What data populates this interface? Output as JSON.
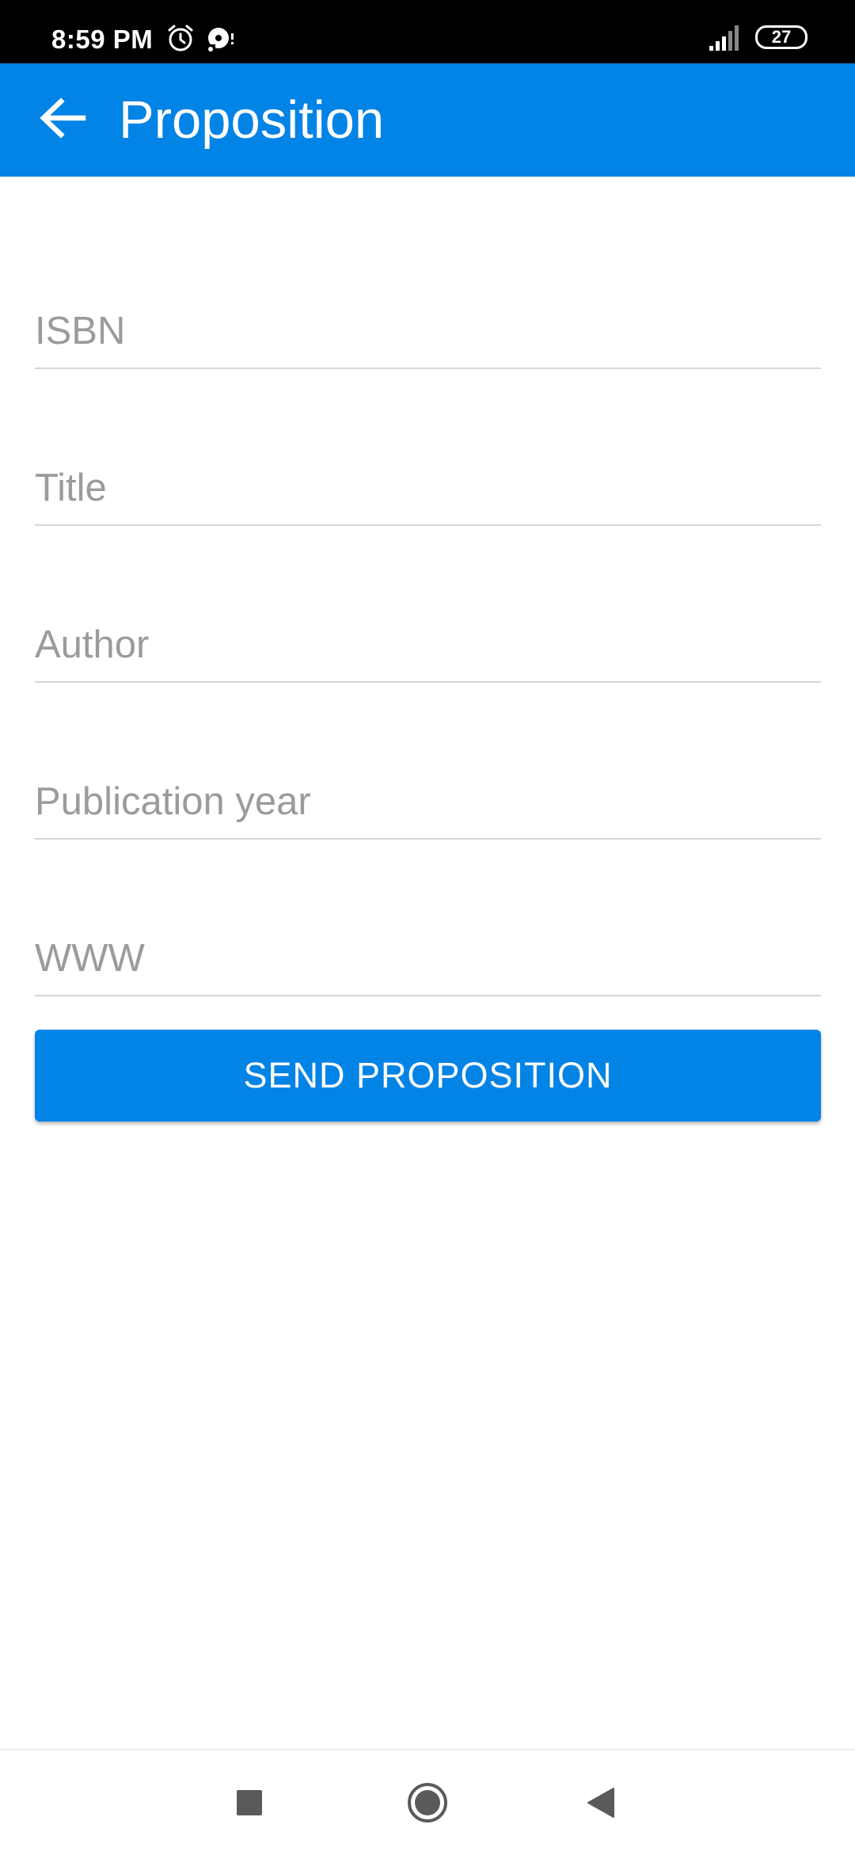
{
  "status_bar": {
    "time": "8:59 PM",
    "battery": "27",
    "icons": [
      "alarm-icon",
      "media-icon",
      "signal-icon",
      "battery-icon"
    ]
  },
  "app_bar": {
    "title": "Proposition",
    "back_icon": "arrow-left-icon",
    "color": "#0283e6"
  },
  "form": {
    "isbn_placeholder": "ISBN",
    "title_placeholder": "Title",
    "author_placeholder": "Author",
    "year_placeholder": "Publication year",
    "www_placeholder": "WWW",
    "isbn_value": "",
    "title_value": "",
    "author_value": "",
    "year_value": "",
    "www_value": ""
  },
  "send_button": {
    "label": "SEND PROPOSITION",
    "color": "#0283e6"
  },
  "nav_bar": {
    "icons": [
      "recents-square-icon",
      "home-circle-icon",
      "back-triangle-icon"
    ]
  }
}
